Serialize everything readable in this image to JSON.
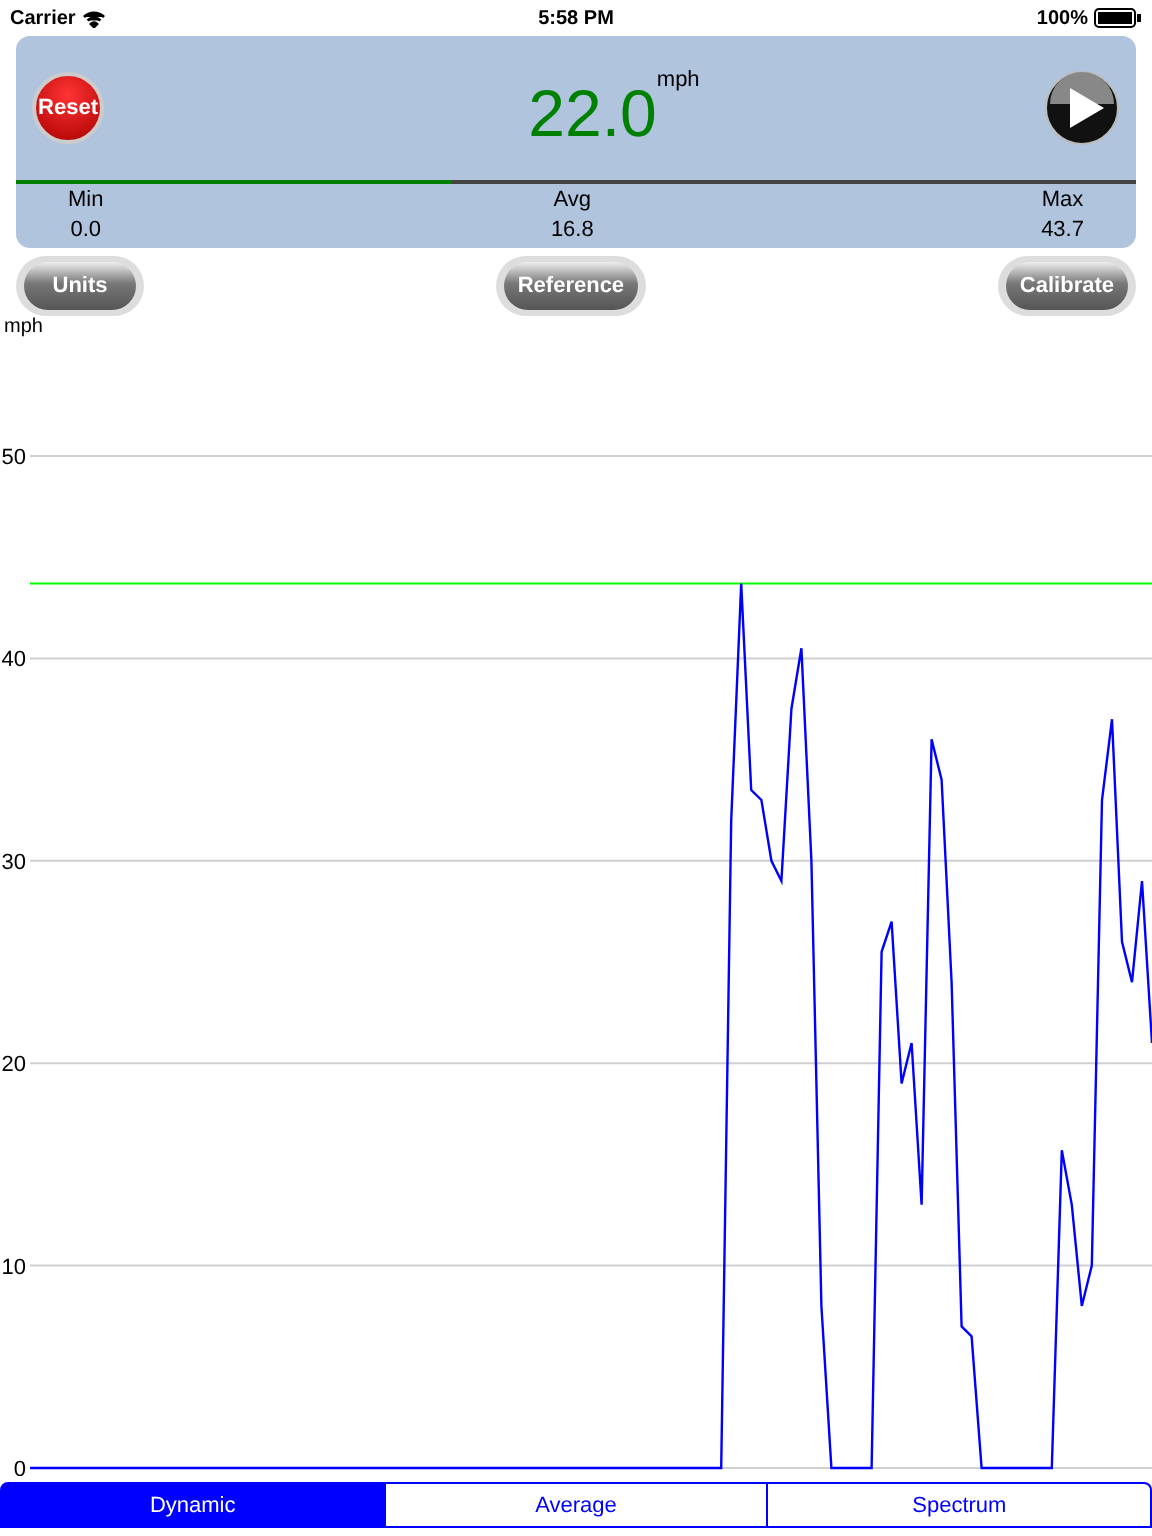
{
  "status_bar": {
    "carrier": "Carrier",
    "time": "5:58 PM",
    "battery": "100%"
  },
  "speed_panel": {
    "reset_label": "Reset",
    "speed": "22.0",
    "unit": "mph",
    "level": 0.39,
    "stats": [
      {
        "label": "Min",
        "value": "0.0"
      },
      {
        "label": "Avg",
        "value": "16.8"
      },
      {
        "label": "Max",
        "value": "43.7"
      }
    ]
  },
  "buttons": [
    "Units",
    "Reference",
    "Calibrate"
  ],
  "chart": {
    "chart_data": {
      "type": "line",
      "ylabel": "mph",
      "ylim": [
        0,
        50
      ],
      "yticks": [
        0,
        10,
        20,
        30,
        40,
        50
      ],
      "grid": true,
      "categories": [
        null,
        null,
        null,
        null,
        null,
        null,
        null,
        null,
        null,
        null,
        null,
        null,
        null,
        null,
        null,
        null,
        null,
        null,
        null,
        null,
        null,
        null,
        null,
        null,
        null,
        null,
        null,
        null,
        null,
        null,
        null,
        null,
        null,
        null,
        null,
        null,
        null,
        null,
        null,
        null,
        null,
        null,
        null,
        null,
        null,
        null,
        null,
        null,
        null,
        null,
        null,
        null,
        null,
        null,
        null,
        null,
        null,
        null,
        null,
        null,
        null,
        null,
        null,
        null,
        null,
        null,
        null,
        null,
        null,
        null,
        null,
        null,
        null,
        null,
        null,
        null,
        null,
        null,
        null,
        null,
        null,
        null,
        null,
        null,
        null,
        null,
        null,
        null,
        null,
        null,
        null,
        null,
        null,
        null,
        null,
        null,
        null,
        null,
        null,
        null,
        null,
        null,
        null,
        null,
        null,
        null,
        null,
        null,
        null,
        null,
        null,
        null,
        null
      ],
      "series": [
        {
          "color": "#00ff00",
          "values": [
            43.7,
            43.7,
            43.7,
            43.7,
            43.7,
            43.7,
            43.7,
            43.7,
            43.7,
            43.7,
            43.7,
            43.7,
            43.7,
            43.7,
            43.7,
            43.7,
            43.7,
            43.7,
            43.7,
            43.7,
            43.7,
            43.7,
            43.7,
            43.7,
            43.7,
            43.7,
            43.7,
            43.7,
            43.7,
            43.7,
            43.7,
            43.7,
            43.7,
            43.7,
            43.7,
            43.7,
            43.7,
            43.7,
            43.7,
            43.7,
            43.7,
            43.7,
            43.7,
            43.7,
            43.7,
            43.7,
            43.7,
            43.7,
            43.7,
            43.7,
            43.7,
            43.7,
            43.7,
            43.7,
            43.7,
            43.7,
            43.7,
            43.7,
            43.7,
            43.7,
            43.7,
            43.7,
            43.7,
            43.7,
            43.7,
            43.7,
            43.7,
            43.7,
            43.7,
            43.7,
            43.7,
            43.7,
            43.7,
            43.7,
            43.7,
            43.7,
            43.7,
            43.7,
            43.7,
            43.7,
            43.7,
            43.7,
            43.7,
            43.7,
            43.7,
            43.7,
            43.7,
            43.7,
            43.7,
            43.7,
            43.7,
            43.7,
            43.7,
            43.7,
            43.7,
            43.7,
            43.7,
            43.7,
            43.7,
            43.7,
            43.7,
            43.7,
            43.7,
            43.7,
            43.7,
            43.7,
            43.7,
            43.7,
            43.7,
            43.7,
            43.7,
            43.7,
            43.7
          ]
        },
        {
          "color": "#0000ff",
          "values": [
            0,
            0,
            0,
            0,
            0,
            0,
            0,
            0,
            0,
            0,
            0,
            0,
            0,
            0,
            0,
            0,
            0,
            0,
            0,
            0,
            0,
            0,
            0,
            0,
            0,
            0,
            0,
            0,
            0,
            0,
            0,
            0,
            0,
            0,
            0,
            0,
            0,
            0,
            0,
            0,
            0,
            0,
            0,
            0,
            0,
            0,
            0,
            0,
            0,
            0,
            0,
            0,
            0,
            0,
            0,
            0,
            0,
            0,
            0,
            0,
            0,
            0,
            0,
            0,
            0,
            0,
            0,
            0,
            0,
            0,
            32,
            43.7,
            33.5,
            33,
            30,
            29,
            37.5,
            40.5,
            30,
            8,
            0,
            0,
            0,
            0,
            0,
            25.5,
            27,
            19,
            21,
            13,
            36,
            34,
            24,
            7,
            6.5,
            0,
            0,
            0,
            0,
            0,
            0,
            0,
            0,
            15.7,
            13,
            8,
            10,
            33,
            37,
            26,
            24,
            29,
            21
          ]
        }
      ]
    }
  },
  "tabs": [
    {
      "label": "Dynamic",
      "selected": true
    },
    {
      "label": "Average",
      "selected": false
    },
    {
      "label": "Spectrum",
      "selected": false
    }
  ]
}
